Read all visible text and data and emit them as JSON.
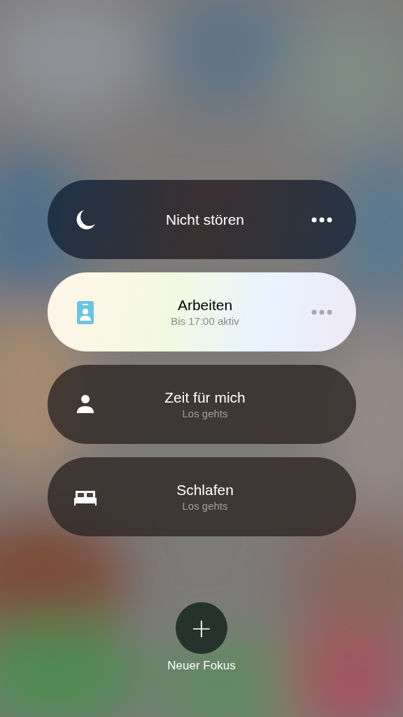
{
  "focus_modes": [
    {
      "kind": "moon",
      "title": "Nicht stören",
      "selected": false,
      "menu": true
    },
    {
      "kind": "badge",
      "title": "Arbeiten",
      "subtitle": "Bis 17:00 aktiv",
      "selected": true,
      "menu": true
    },
    {
      "kind": "person",
      "title": "Zeit für mich",
      "subtitle": "Los gehts",
      "selected": false,
      "menu": false
    },
    {
      "kind": "bed",
      "title": "Schlafen",
      "subtitle": "Los gehts",
      "selected": false,
      "menu": false
    }
  ],
  "new_focus": {
    "icon": "+",
    "label": "Neuer Fokus"
  }
}
